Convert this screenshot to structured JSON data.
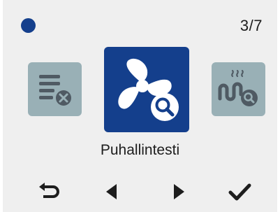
{
  "status": {
    "indicator_color": "#143f8c"
  },
  "pager": {
    "counter": "3/7"
  },
  "carousel": {
    "selected_label": "Puhallintesti",
    "items": [
      {
        "icon": "list-remove-icon",
        "state": "inactive"
      },
      {
        "icon": "fan-search-icon",
        "state": "selected"
      },
      {
        "icon": "heater-search-icon",
        "state": "inactive"
      }
    ]
  },
  "colors": {
    "accent": "#143f8c",
    "tile_inactive": "#99b0b6",
    "background": "#efefef",
    "icon_dark": "#1d1d1d"
  },
  "nav": {
    "back_icon": "back-arrow-icon",
    "prev_icon": "left-triangle-icon",
    "next_icon": "right-triangle-icon",
    "ok_icon": "checkmark-icon"
  }
}
